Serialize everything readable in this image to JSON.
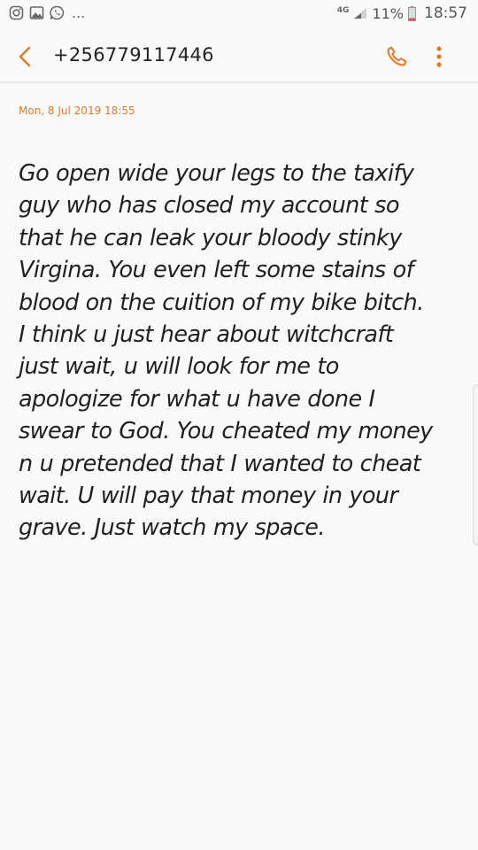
{
  "status_bar": {
    "left_icons": [
      "instagram-icon",
      "gallery-icon",
      "whatsapp-icon"
    ],
    "more_indicator": "...",
    "network_type": "4G",
    "battery_percent": "11%",
    "time": "18:57"
  },
  "header": {
    "back_icon": "chevron-left-icon",
    "title": "+256779117446",
    "call_icon": "phone-icon",
    "more_icon": "more-vertical-icon",
    "accent_color": "#e07a2a"
  },
  "message": {
    "date": "Mon, 8 Jul 2019 18:55",
    "lines": [
      "Go open wide your legs to the taxify",
      "guy who has closed my account so",
      "that he can leak your  bloody stinky",
      "Virgina. You even left some stains of",
      "blood on the cuition of my bike bitch.",
      "I think u just hear about witchcraft",
      "just wait,  u will look for me to",
      "apologize for what u have done I",
      "swear to God. You cheated my money",
      "n u pretended that I wanted to cheat",
      "wait. U will pay that money in your",
      "grave. Just watch my space."
    ]
  }
}
